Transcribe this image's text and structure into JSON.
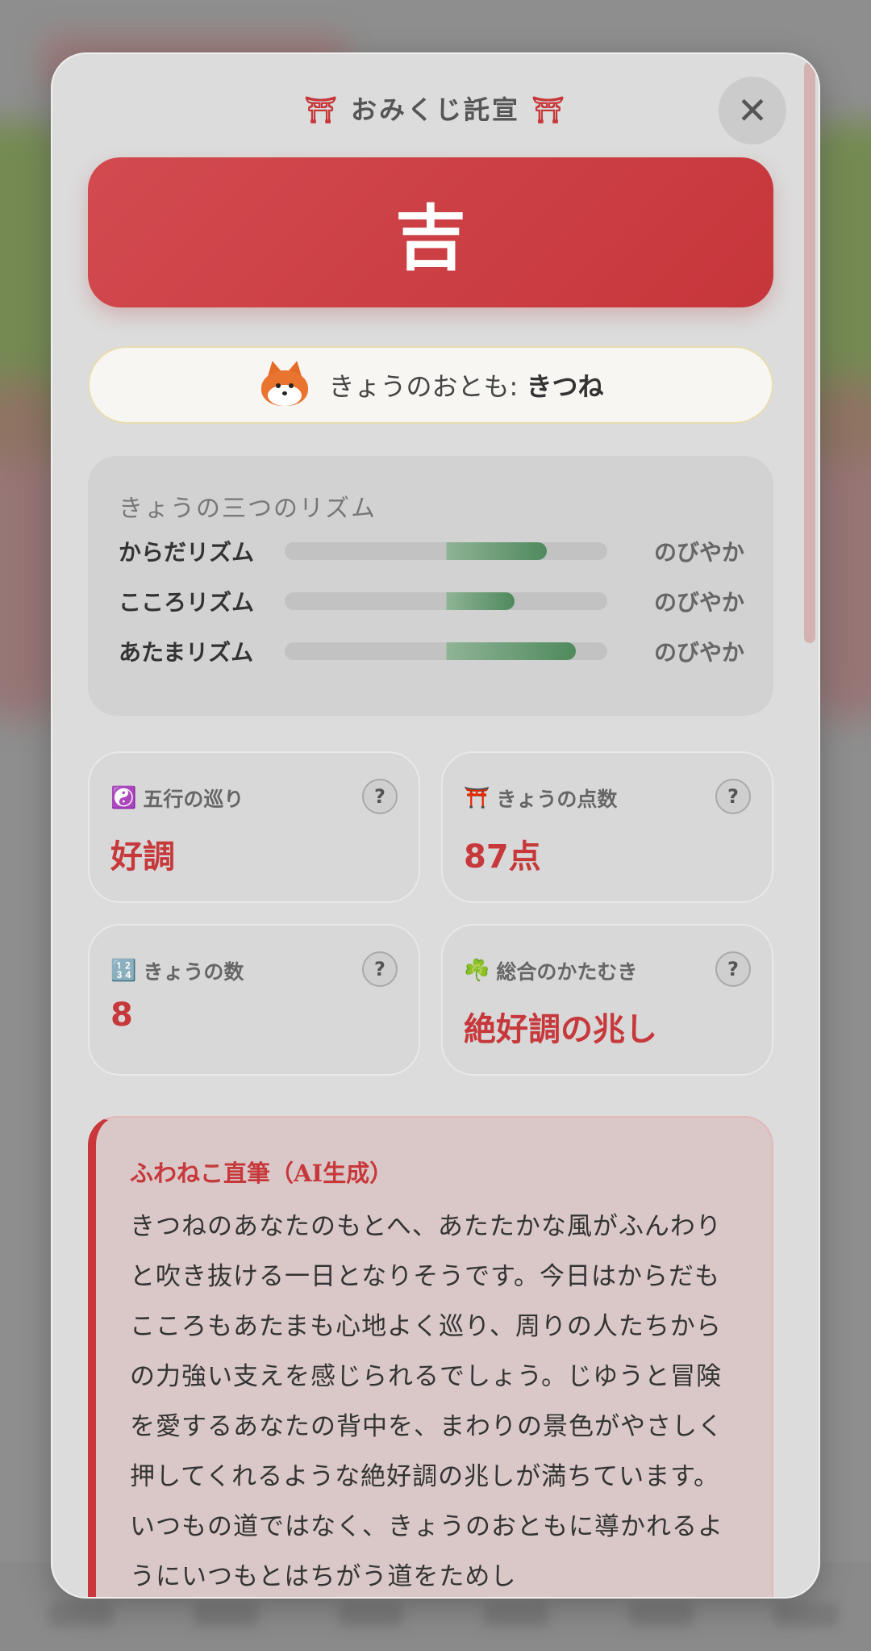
{
  "modal": {
    "title": "おみくじ託宣",
    "title_icon": "torii-icon",
    "close_label": "✕"
  },
  "fortune": {
    "result": "吉"
  },
  "companion": {
    "prefix": "きょうのおとも: ",
    "animal": "きつね",
    "icon": "fox-icon"
  },
  "rhythm": {
    "title": "きょうの三つのリズム",
    "rows": [
      {
        "label": "からだリズム",
        "value": "のびやか",
        "level": 0.31
      },
      {
        "label": "こころリズム",
        "value": "のびやか",
        "level": 0.21
      },
      {
        "label": "あたまリズム",
        "value": "のびやか",
        "level": 0.4
      }
    ]
  },
  "stats": [
    {
      "emoji": "☯️",
      "label": "五行の巡り",
      "value": "好調",
      "help": "?"
    },
    {
      "emoji": "⛩️",
      "label": "きょうの点数",
      "value": "87点",
      "help": "?"
    },
    {
      "emoji": "🔢",
      "label": "きょうの数",
      "value": "8",
      "help": "?"
    },
    {
      "emoji": "☘️",
      "label": "総合のかたむき",
      "value": "絶好調の兆し",
      "help": "?"
    }
  ],
  "essay": {
    "title": "ふわねこ直筆（AI生成）",
    "text": "きつねのあなたのもとへ、あたたかな風がふんわりと吹き抜ける一日となりそうです。今日はからだもこころもあたまも心地よく巡り、周りの人たちからの力強い支えを感じられるでしょう。じゆうと冒険を愛するあなたの背中を、まわりの景色がやさしく押してくれるような絶好調の兆しが満ちています。いつもの道ではなく、きょうのおともに導かれるようにいつもとはちがう道をためし"
  },
  "colors": {
    "accent_red": "#c7383b",
    "rhythm_green": "#4f8a5c"
  }
}
